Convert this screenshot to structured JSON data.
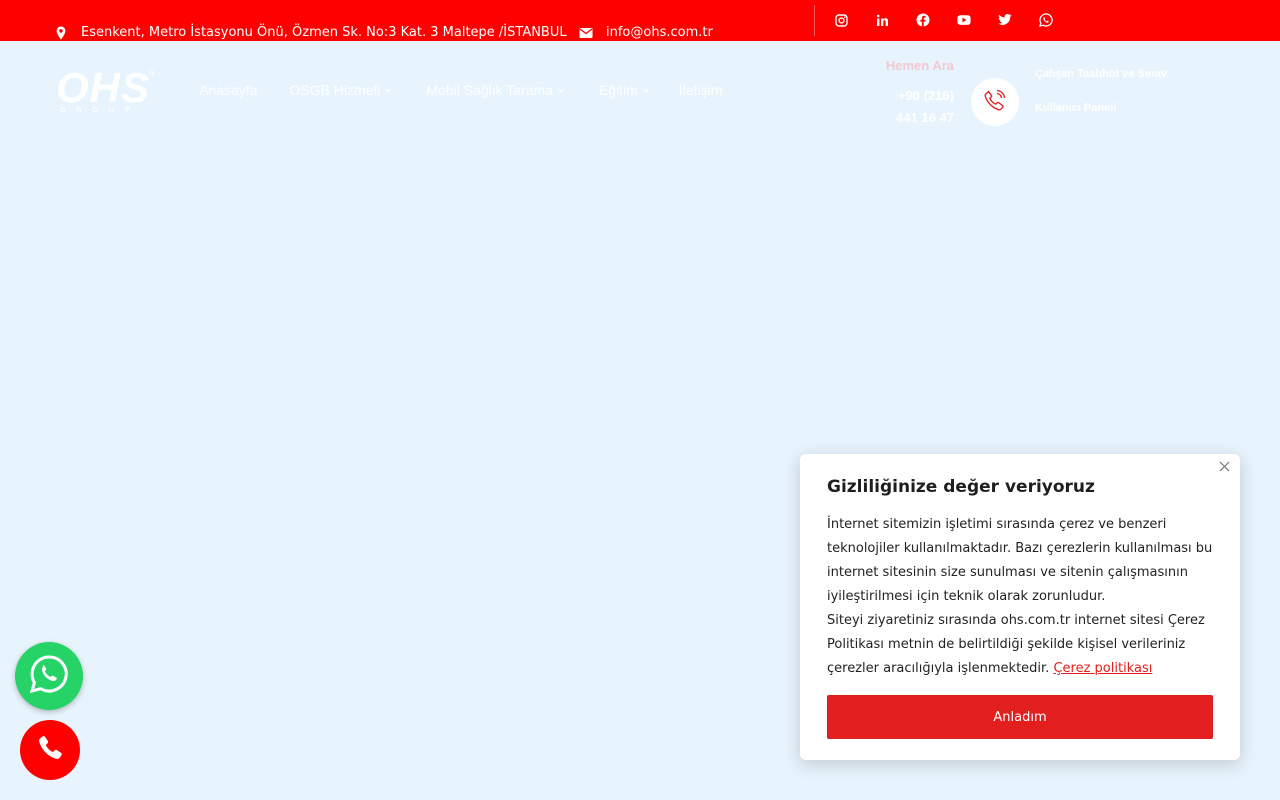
{
  "topbar": {
    "address": "Esenkent, Metro İstasyonu Önü, Özmen Sk. No:3 Kat. 3 Maltepe /İSTANBUL",
    "email": "info@ohs.com.tr",
    "socials": [
      "instagram-icon",
      "linkedin-icon",
      "facebook-icon",
      "youtube-icon",
      "twitter-icon",
      "whatsapp-icon"
    ],
    "background": "#ff0000"
  },
  "logo": {
    "main": "OHS",
    "sub": "GROUP"
  },
  "nav": {
    "items": [
      {
        "label": "Anasayfa",
        "dropdown": false
      },
      {
        "label": "OSGB Hizmeti",
        "dropdown": true
      },
      {
        "label": "Mobil Sağlık Tarama",
        "dropdown": true
      },
      {
        "label": "Eğitim",
        "dropdown": true
      },
      {
        "label": "İletişim",
        "dropdown": false
      }
    ]
  },
  "contact": {
    "label": "Hemen Ara",
    "phone_line1": "+90 (216)",
    "phone_line2": "441 16 47",
    "icon": "phone-ringing-icon"
  },
  "header_links": {
    "link1": "Çalışan Taahhüt ve Sınav",
    "link2": "Kullanıcı Paneli"
  },
  "floating": {
    "whatsapp_icon": "whatsapp-icon",
    "whatsapp_color": "#25d366",
    "call_icon": "phone-icon",
    "call_color": "#ff0000"
  },
  "cookie": {
    "title": "Gizliliğinize değer veriyoruz",
    "text1": "İnternet sitemizin işletimi sırasında çerez ve benzeri teknolojiler kullanılmaktadır. Bazı çerezlerin kullanılması bu internet sitesinin size sunulması ve sitenin çalışmasının iyileştirilmesi için teknik olarak zorunludur.",
    "text2": "Siteyi ziyaretiniz sırasında ohs.com.tr internet sitesi Çerez Politikası metnin de belirtildiği şekilde kişisel verileriniz çerezler aracılığıyla işlenmektedir.",
    "link": "Çerez politikası",
    "button": "Anladım",
    "accent": "#e21e1e"
  }
}
